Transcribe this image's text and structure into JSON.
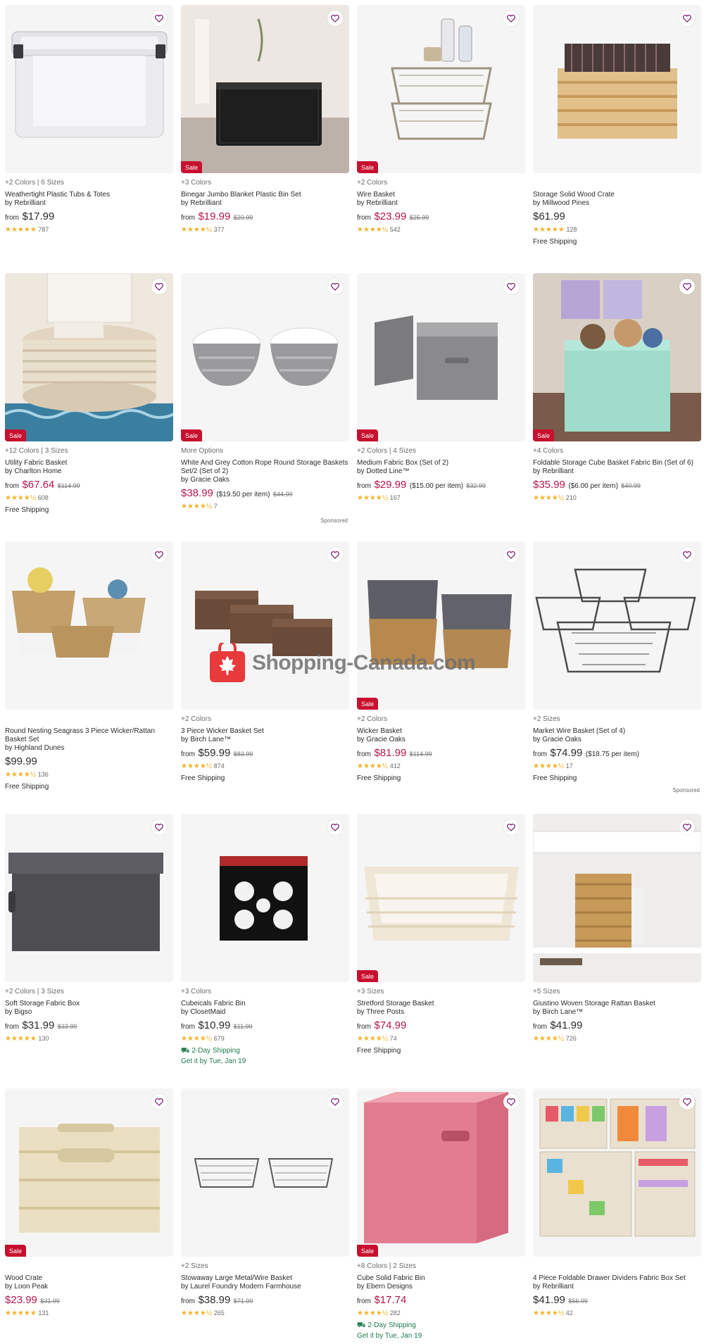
{
  "watermark": "Shopping-Canada.com",
  "products": [
    {
      "opts": "+2 Colors | 6 Sizes",
      "name": "Weathertight Plastic Tubs & Totes",
      "by": "by Rebrilliant",
      "from": "from",
      "price": "$17.99",
      "per": "",
      "was": "",
      "sale": false,
      "stars": "★★★★★",
      "reviews": "787",
      "shipping": "",
      "getit": "",
      "art": "tote"
    },
    {
      "opts": "+3 Colors",
      "name": "Binegar Jumbo Blanket Plastic Bin Set",
      "by": "by Rebrilliant",
      "from": "from",
      "price": "$19.99",
      "per": "",
      "was": "$20.99",
      "sale": true,
      "stars": "★★★★½",
      "reviews": "377",
      "shipping": "",
      "getit": "",
      "art": "bag"
    },
    {
      "opts": "+2 Colors",
      "name": "Wire Basket",
      "by": "by Rebrilliant",
      "from": "from",
      "price": "$23.99",
      "per": "",
      "was": "$25.99",
      "sale": true,
      "stars": "★★★★½",
      "reviews": "542",
      "shipping": "",
      "getit": "",
      "art": "wirestack"
    },
    {
      "opts": "",
      "name": "Storage Solid Wood Crate",
      "by": "by Millwood Pines",
      "from": "",
      "price": "$61.99",
      "per": "",
      "was": "",
      "sale": false,
      "stars": "★★★★★",
      "reviews": "128",
      "shipping": "Free Shipping",
      "getit": "",
      "art": "woodcrate"
    },
    {
      "opts": "+12 Colors | 3 Sizes",
      "name": "Utility Fabric Basket",
      "by": "by Charlton Home",
      "from": "from",
      "price": "$67.64",
      "per": "",
      "was": "$114.99",
      "sale": true,
      "stars": "★★★★½",
      "reviews": "608",
      "shipping": "Free Shipping",
      "getit": "",
      "art": "rope"
    },
    {
      "opts": "More Options",
      "name": "White And Grey Cotton Rope Round Storage Baskets Set/2 (Set of 2)",
      "by": "by Gracie Oaks",
      "from": "",
      "price": "$38.99",
      "per": "($19.50 per item)",
      "was": "$44.99",
      "sale": true,
      "stars": "★★★★½",
      "reviews": "7",
      "shipping": "",
      "getit": "",
      "art": "ropepair",
      "sponsored": "Sponsored"
    },
    {
      "opts": "+2 Colors | 4 Sizes",
      "name": "Medium Fabric Box (Set of 2)",
      "by": "by Dotted Line™",
      "from": "from",
      "price": "$29.99",
      "per": "($15.00 per item)",
      "was": "$32.99",
      "sale": true,
      "stars": "★★★★½",
      "reviews": "167",
      "shipping": "",
      "getit": "",
      "art": "greybox"
    },
    {
      "opts": "+4 Colors",
      "name": "Foldable Storage Cube Basket Fabric Bin (Set of 6)",
      "by": "by Rebrilliant",
      "from": "",
      "price": "$35.99",
      "per": "($6.00 per item)",
      "was": "$40.99",
      "sale": true,
      "stars": "★★★★½",
      "reviews": "210",
      "shipping": "",
      "getit": "",
      "art": "mint"
    },
    {
      "opts": "",
      "name": "Round Nesting Seagrass 3 Piece Wicker/Rattan Basket Set",
      "by": "by Highland Dunes",
      "from": "",
      "price": "$99.99",
      "per": "",
      "was": "",
      "sale": false,
      "stars": "★★★★½",
      "reviews": "136",
      "shipping": "Free Shipping",
      "getit": "",
      "art": "seagrass"
    },
    {
      "opts": "+2 Colors",
      "name": "3 Piece Wicker Basket Set",
      "by": "by Birch Lane™",
      "from": "from",
      "price": "$59.99",
      "per": "",
      "was": "$83.99",
      "sale": false,
      "stars": "★★★★½",
      "reviews": "874",
      "shipping": "Free Shipping",
      "getit": "",
      "art": "wickerset"
    },
    {
      "opts": "+2 Colors",
      "name": "Wicker Basket",
      "by": "by Gracie Oaks",
      "from": "from",
      "price": "$81.99",
      "per": "",
      "was": "$114.99",
      "sale": true,
      "stars": "★★★★½",
      "reviews": "412",
      "shipping": "Free Shipping",
      "getit": "",
      "art": "wickerpair"
    },
    {
      "opts": "+2 Sizes",
      "name": "Market Wire Basket (Set of 4)",
      "by": "by Gracie Oaks",
      "from": "from",
      "price": "$74.99",
      "per": "($18.75 per item)",
      "was": "",
      "sale": false,
      "stars": "★★★★½",
      "reviews": "17",
      "shipping": "Free Shipping",
      "getit": "",
      "art": "wirefour",
      "sponsored": "Sponsored"
    },
    {
      "opts": "+2 Colors | 3 Sizes",
      "name": "Soft Storage Fabric Box",
      "by": "by Bigso",
      "from": "from",
      "price": "$31.99",
      "per": "",
      "was": "$33.99",
      "sale": false,
      "stars": "★★★★★",
      "reviews": "130",
      "shipping": "",
      "getit": "",
      "art": "darkbox"
    },
    {
      "opts": "+3 Colors",
      "name": "Cubeicals Fabric Bin",
      "by": "by ClosetMaid",
      "from": "from",
      "price": "$10.99",
      "per": "",
      "was": "$11.99",
      "sale": false,
      "stars": "★★★★½",
      "reviews": "679",
      "shipping": "2-Day Shipping",
      "getit": "Get it by Tue, Jan 19",
      "art": "damask"
    },
    {
      "opts": "+3 Sizes",
      "name": "Stretford Storage Basket",
      "by": "by Three Posts",
      "from": "from",
      "price": "$74.99",
      "per": "",
      "was": "",
      "sale": true,
      "stars": "★★★★½",
      "reviews": "74",
      "shipping": "Free Shipping",
      "getit": "",
      "art": "tray"
    },
    {
      "opts": "+5 Sizes",
      "name": "Giustino Woven Storage Rattan Basket",
      "by": "by Birch Lane™",
      "from": "from",
      "price": "$41.99",
      "per": "",
      "was": "",
      "sale": false,
      "stars": "★★★★½",
      "reviews": "726",
      "shipping": "",
      "getit": "",
      "art": "shelf"
    },
    {
      "opts": "",
      "name": "Wood Crate",
      "by": "by Loon Peak",
      "from": "",
      "price": "$23.99",
      "per": "",
      "was": "$31.99",
      "sale": true,
      "stars": "★★★★★",
      "reviews": "131",
      "shipping": "",
      "getit": "",
      "art": "plaincrate"
    },
    {
      "opts": "+2 Sizes",
      "name": "Stowaway Large Metal/Wire Basket",
      "by": "by Laurel Foundry Modern Farmhouse",
      "from": "from",
      "price": "$38.99",
      "per": "",
      "was": "$71.99",
      "sale": false,
      "stars": "★★★★½",
      "reviews": "265",
      "shipping": "",
      "getit": "",
      "art": "wiretrays"
    },
    {
      "opts": "+8 Colors | 2 Sizes",
      "name": "Cube Solid Fabric Bin",
      "by": "by Ebern Designs",
      "from": "from",
      "price": "$17.74",
      "per": "",
      "was": "",
      "sale": true,
      "stars": "★★★★½",
      "reviews": "282",
      "shipping": "2-Day Shipping",
      "getit": "Get it by Tue, Jan 19",
      "art": "pinkcube"
    },
    {
      "opts": "",
      "name": "4 Piece Foldable Drawer Dividers Fabric Box Set",
      "by": "by Rebrilliant",
      "from": "",
      "price": "$41.99",
      "per": "",
      "was": "$56.99",
      "sale": false,
      "stars": "★★★★½",
      "reviews": "42",
      "shipping": "",
      "getit": "",
      "art": "dividers"
    }
  ],
  "labels": {
    "sale_badge": "Sale",
    "sponsored": "Sponsored"
  },
  "colors": {
    "sale": "#c8102e",
    "price_sale": "#b5164f",
    "shipping_fast": "#1f7a4d",
    "star": "#f0b429"
  }
}
